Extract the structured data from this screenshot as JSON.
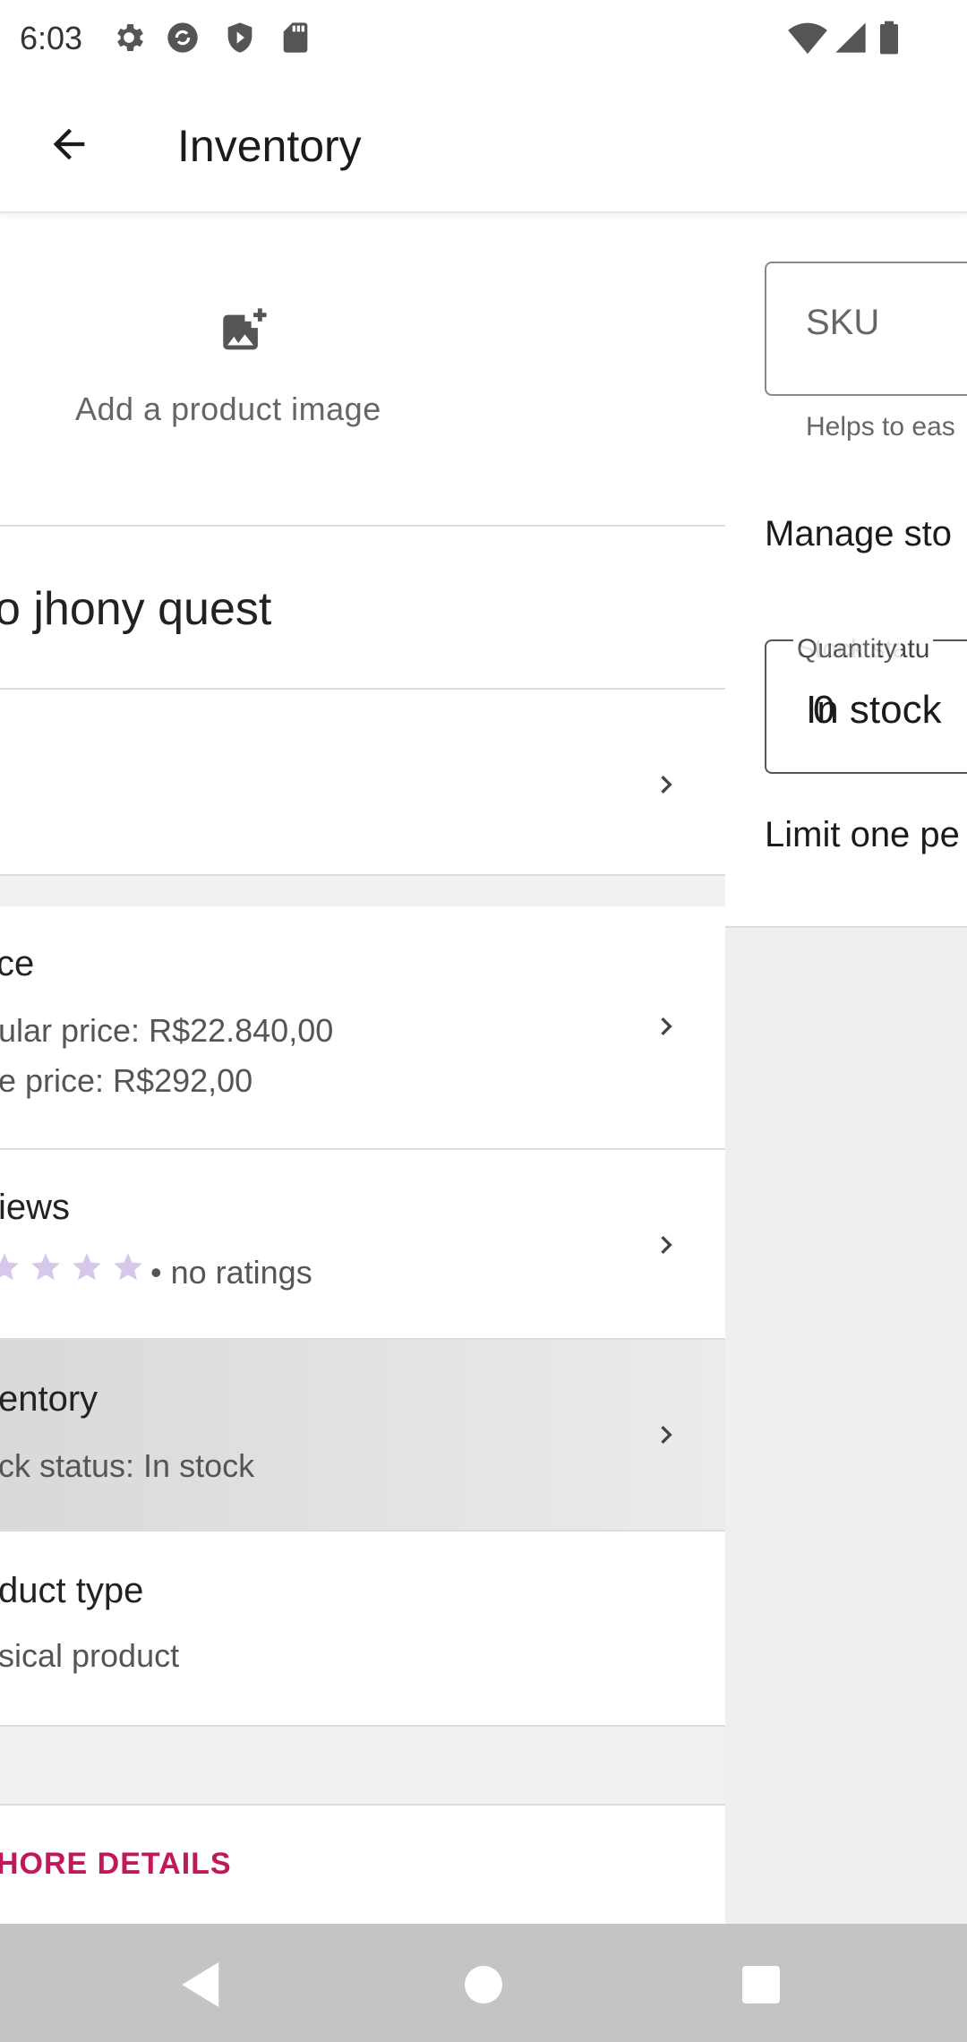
{
  "status_bar": {
    "time": "6:03",
    "left_icons": [
      "settings-icon",
      "sync-icon",
      "shield-icon",
      "sd-card-icon"
    ],
    "right_icons": [
      "wifi-icon",
      "signal-icon",
      "battery-icon"
    ]
  },
  "app_bar": {
    "title": "Inventory",
    "back_icon": "arrow-back-icon"
  },
  "product": {
    "add_image_label": "Add a product image",
    "title": "o jhony quest",
    "rows": [
      {
        "title": "ce",
        "lines": [
          "ular price: R$22.840,00",
          "e price: R$292,00"
        ]
      },
      {
        "title": "iews",
        "rating_text": "• no ratings",
        "stars": 4
      },
      {
        "title": "entory",
        "lines": [
          "ck status: In stock"
        ]
      },
      {
        "title": "duct type",
        "lines": [
          "sical product"
        ]
      }
    ],
    "more_details": "HORE DETAILS"
  },
  "inventory": {
    "sku_placeholder": "SKU",
    "sku_helper": "Helps to eas",
    "manage_stock_label": "Manage sto",
    "stock_label_a": "Stock statu",
    "stock_label_b": "Quantity",
    "stock_value_a": "In stock",
    "stock_value_b": "0",
    "limit_one_label": "Limit one pe"
  },
  "colors": {
    "accent": "#c2185b",
    "star": "#d6c8ea",
    "nav_bar": "#c4c4c4"
  }
}
